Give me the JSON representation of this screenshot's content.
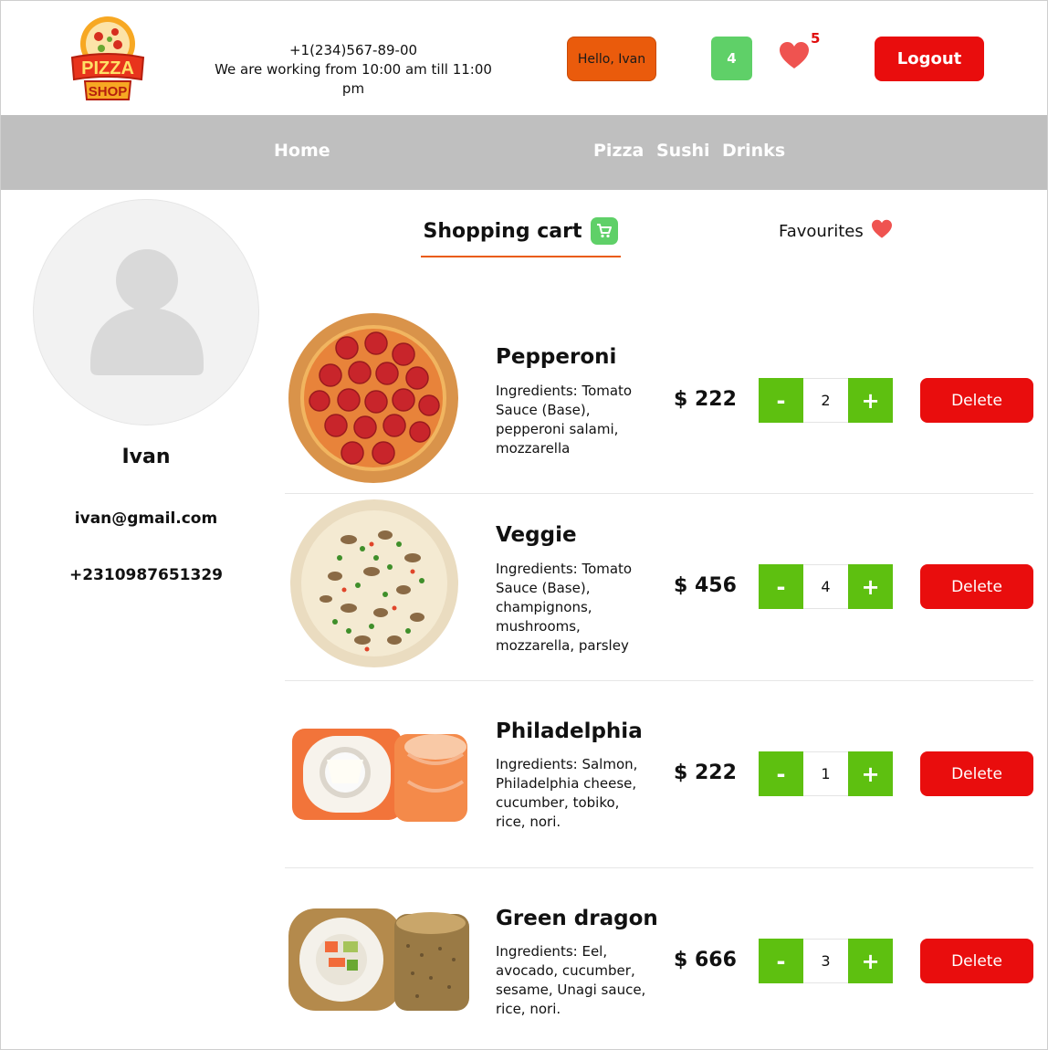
{
  "header": {
    "logo_text_top": "PIZZA",
    "logo_text_bottom": "SHOP",
    "phone": "+1(234)567-89-00",
    "hours": "We are working from 10:00 am till 11:00 pm",
    "hello_label": "Hello, Ivan",
    "cart_count": "4",
    "favourites_count": "5",
    "logout_label": "Logout"
  },
  "nav": {
    "items": [
      "Home",
      "Pizza",
      "Sushi",
      "Drinks"
    ]
  },
  "profile": {
    "name": "Ivan",
    "email": "ivan@gmail.com",
    "phone": "+2310987651329"
  },
  "tabs": {
    "cart_label": "Shopping cart",
    "favourites_label": "Favourites"
  },
  "cart": {
    "items": [
      {
        "name": "Pepperoni",
        "ingredients": "Ingredients: Tomato Sauce (Base), pepperoni salami, mozzarella",
        "price": "$ 222",
        "quantity": "2",
        "minus": "-",
        "plus": "+",
        "delete_label": "Delete"
      },
      {
        "name": "Veggie",
        "ingredients": "Ingredients: Tomato Sauce (Base), champignons, mushrooms, mozzarella, parsley",
        "price": "$ 456",
        "quantity": "4",
        "minus": "-",
        "plus": "+",
        "delete_label": "Delete"
      },
      {
        "name": "Philadelphia",
        "ingredients": "Ingredients: Salmon, Philadelphia cheese, cucumber, tobiko, rice, nori.",
        "price": "$ 222",
        "quantity": "1",
        "minus": "-",
        "plus": "+",
        "delete_label": "Delete"
      },
      {
        "name": "Green dragon",
        "ingredients": "Ingredients: Eel, avocado, cucumber, sesame, Unagi sauce, rice, nori.",
        "price": "$ 666",
        "quantity": "3",
        "minus": "-",
        "plus": "+",
        "delete_label": "Delete"
      }
    ]
  },
  "colors": {
    "accent_orange": "#ea5b0c",
    "cart_green": "#5fd068",
    "qty_green": "#5ec010",
    "danger_red": "#e90d0d",
    "nav_gray": "#bfbfbf"
  },
  "icons": [
    "pizza-shop-logo",
    "heart-icon",
    "shopping-cart-icon",
    "user-avatar-icon"
  ]
}
